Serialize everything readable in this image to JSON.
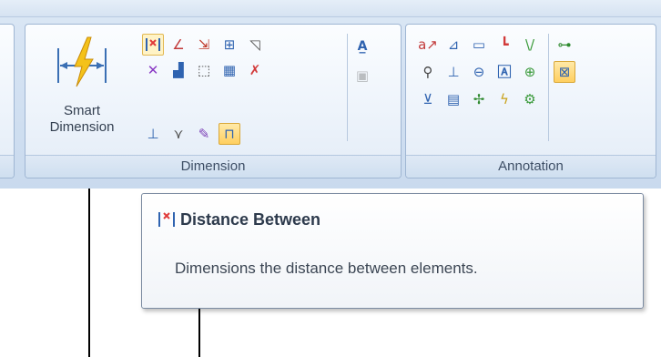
{
  "ribbon": {
    "groups": [
      {
        "label": "Dimension"
      },
      {
        "label": "Annotation"
      }
    ],
    "smart_dimension": {
      "line1": "Smart",
      "line2": "Dimension"
    }
  },
  "tooltip": {
    "title": "Distance Between",
    "description": "Dimensions the distance between elements."
  },
  "colors": {
    "ribbon_bg": "#dbe7f5",
    "group_border": "#9fb6d3",
    "selected_tool": "#ffcf5f",
    "tooltip_border": "#7b8ba1"
  },
  "icons": [
    "smart-dimension-icon",
    "distance-between-icon",
    "angle-dimension-icon",
    "symmetric-diameter-icon",
    "coordinate-dimension-icon",
    "chamfer-dimension-icon",
    "text-style-icon",
    "callout-icon",
    "balloon-icon",
    "feature-control-frame-icon",
    "surface-texture-icon",
    "weld-symbol-icon",
    "datum-target-icon",
    "center-mark-icon",
    "bolt-circle-icon",
    "leader-icon"
  ]
}
